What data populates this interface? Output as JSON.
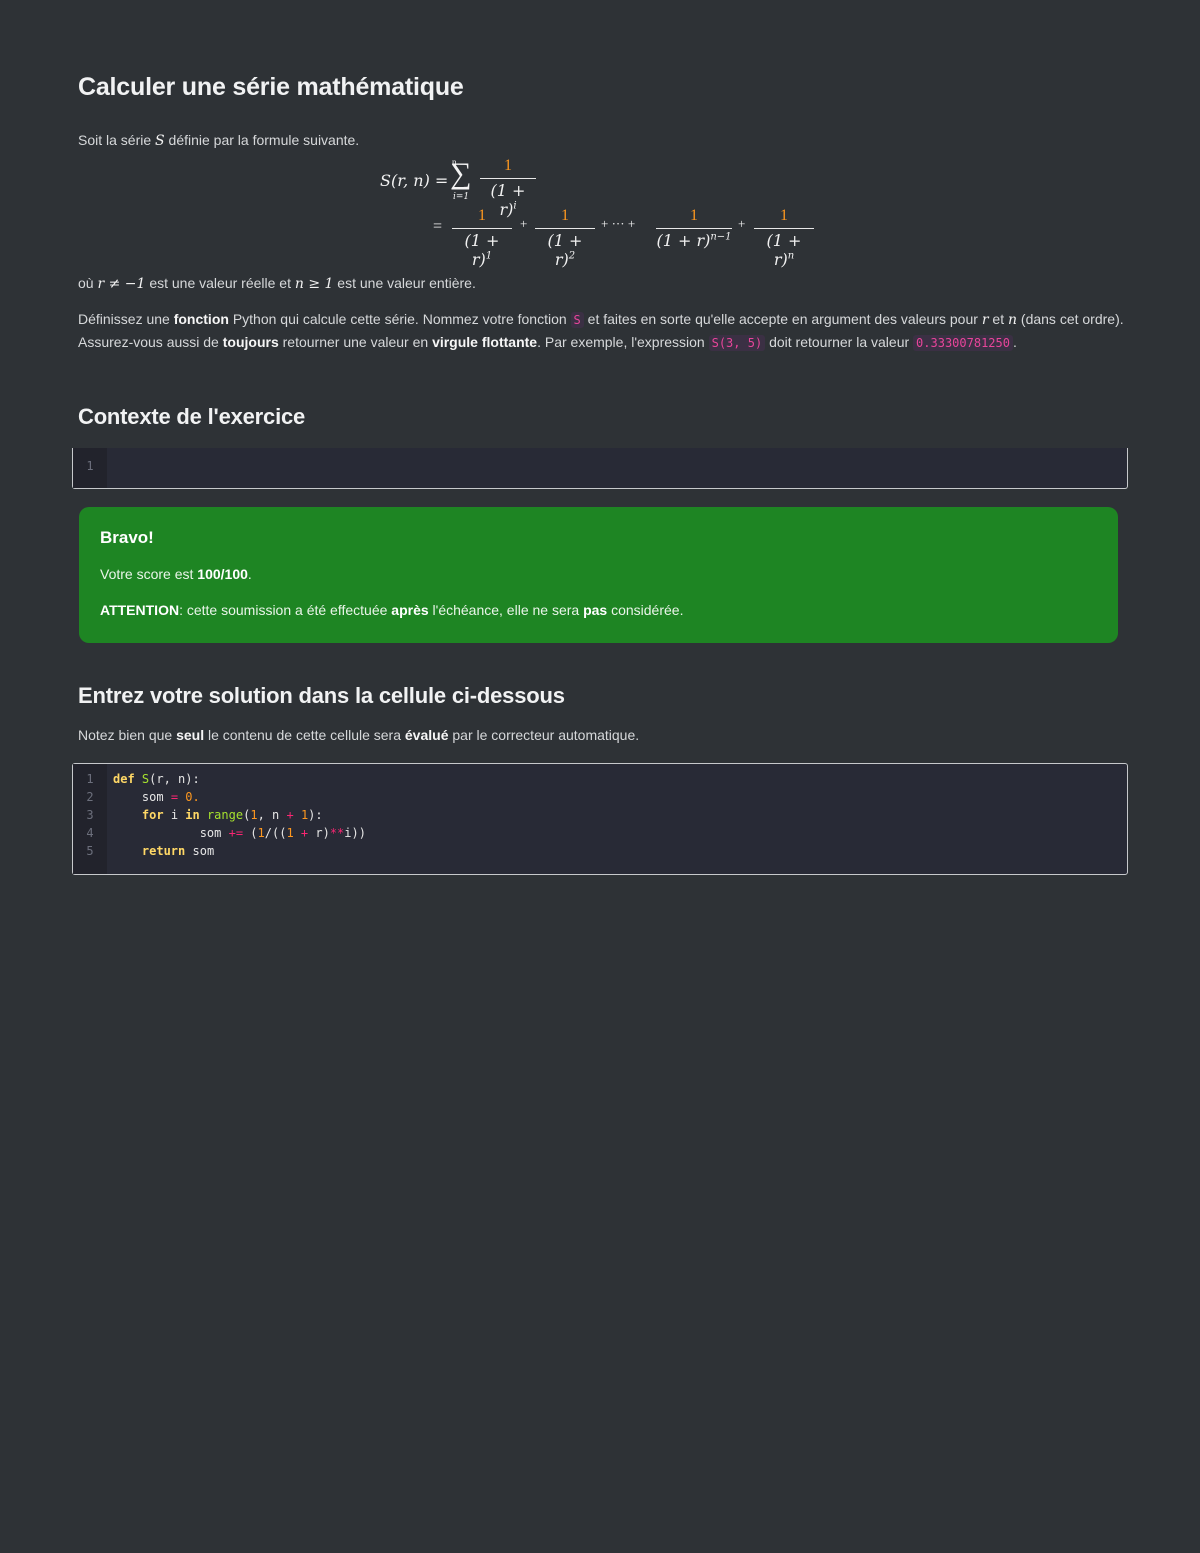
{
  "title": "Calculer une série mathématique",
  "intro": {
    "before": "Soit la série ",
    "symbol": "S",
    "after": " définie par la formule suivante."
  },
  "formula": {
    "lhs": "S(r, n) =",
    "sum_top": "n",
    "sum_bottom": "i=1",
    "sigma": "∑",
    "frac_one": "1",
    "den_i": "(1 + r)",
    "exp_i": "i",
    "eq": "=",
    "den": "(1 + r)",
    "exp_1": "1",
    "exp_2": "2",
    "exp_nm1": "n−1",
    "exp_n": "n",
    "plus": "+",
    "dots": "+ ··· +"
  },
  "where": {
    "prefix": "où ",
    "cond_r": "r ≠ −1",
    "mid": " est une valeur réelle et ",
    "cond_n": "n ≥ 1",
    "suffix": " est une valeur entière."
  },
  "instructions": {
    "t1": "Définissez une ",
    "b1": "fonction",
    "t2": " Python qui calcule cette série. Nommez votre fonction ",
    "c1": "S",
    "t3": " et faites en sorte qu'elle accepte en argument des valeurs pour ",
    "v_r": "r",
    "t4": " et ",
    "v_n": "n",
    "t5": " (dans cet ordre). Assurez-vous aussi de ",
    "b2": "toujours",
    "t6": " retourner une valeur en ",
    "b3": "virgule flottante",
    "t7": ". Par exemple, l'expression ",
    "c2": "S(3, 5)",
    "t8": " doit retourner la valeur ",
    "c3": "0.33300781250",
    "t9": "."
  },
  "context_heading": "Contexte de l'exercice",
  "context_cell": {
    "line_numbers": [
      "1"
    ]
  },
  "alert": {
    "title": "Bravo!",
    "score_prefix": "Votre score est ",
    "score": "100/100",
    "score_suffix": ".",
    "warn_label": "ATTENTION",
    "warn_t1": ": cette soumission a été effectuée ",
    "warn_b1": "après",
    "warn_t2": " l'échéance, elle ne sera ",
    "warn_b2": "pas",
    "warn_t3": " considérée."
  },
  "solution_heading": "Entrez votre solution dans la cellule ci-dessous",
  "note": {
    "t1": "Notez bien que ",
    "b1": "seul",
    "t2": " le contenu de cette cellule sera ",
    "b2": "évalué",
    "t3": " par le correcteur automatique."
  },
  "code_cell": {
    "line_numbers": [
      "1",
      "2",
      "3",
      "4",
      "5"
    ],
    "tokens": {
      "def": "def",
      "fname": "S",
      "sig": "(r, n):",
      "l2_indent": "    ",
      "l2_var": "som",
      "l2_eq": " = ",
      "l2_val": "0.",
      "l3_indent": "    ",
      "l3_for": "for",
      "l3_i": " i ",
      "l3_in": "in",
      "l3_range": " range",
      "l3_p1": "(",
      "l3_one": "1",
      "l3_mid": ", n ",
      "l3_plus": "+",
      "l3_sp": " ",
      "l3_one2": "1",
      "l3_end": "):",
      "l4_indent": "            ",
      "l4_var": "som ",
      "l4_op": "+=",
      "l4_a": " (",
      "l4_one": "1",
      "l4_b": "/((",
      "l4_one2": "1",
      "l4_c": " ",
      "l4_plus": "+",
      "l4_d": " r)",
      "l4_pow": "**",
      "l4_e": "i))",
      "l5_indent": "    ",
      "l5_ret": "return",
      "l5_var": " som"
    }
  }
}
